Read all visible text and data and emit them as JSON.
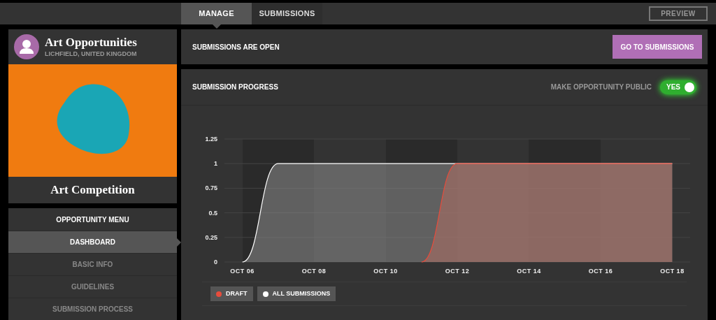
{
  "tabs": [
    {
      "label": "MANAGE",
      "selected": true
    },
    {
      "label": "SUBMISSIONS",
      "selected": false
    }
  ],
  "preview_button": "PREVIEW",
  "profile": {
    "name": "Art Opportunities",
    "location": "LICHFIELD, UNITED KINGDOM"
  },
  "opportunity": {
    "title": "Art Competition"
  },
  "menu": {
    "heading": "OPPORTUNITY MENU",
    "items": [
      {
        "label": "DASHBOARD",
        "selected": true
      },
      {
        "label": "BASIC INFO",
        "selected": false
      },
      {
        "label": "GUIDELINES",
        "selected": false
      },
      {
        "label": "SUBMISSION PROCESS",
        "selected": false
      }
    ]
  },
  "status": {
    "text": "SUBMISSIONS ARE OPEN",
    "button": "GO TO SUBMISSIONS"
  },
  "progress": {
    "title": "SUBMISSION PROGRESS",
    "public_label": "MAKE OPPORTUNITY PUBLIC",
    "public_on": true,
    "public_text": "YES",
    "chart_data": {
      "type": "area",
      "categories": [
        "OCT 06",
        null,
        "OCT 08",
        null,
        "OCT 10",
        null,
        "OCT 12",
        null,
        "OCT 14",
        null,
        "OCT 16",
        null,
        "OCT 18"
      ],
      "ylim": [
        0,
        1.25
      ],
      "grid": true,
      "yticks": [
        0,
        0.25,
        {
          "value": 0.5,
          "label": "0.5"
        },
        0.75,
        {
          "value": 1,
          "label": "1"
        },
        1.25
      ],
      "series": [
        {
          "name": "ALL SUBMISSIONS",
          "color": "#ffffff",
          "values": [
            0,
            1,
            1,
            1,
            1,
            1,
            1,
            1,
            1,
            1,
            1,
            1,
            1
          ]
        },
        {
          "name": "DRAFT",
          "color": "#e74c3c",
          "values": [
            null,
            null,
            null,
            null,
            null,
            0,
            1,
            1,
            1,
            1,
            1,
            1,
            1
          ]
        }
      ]
    }
  }
}
